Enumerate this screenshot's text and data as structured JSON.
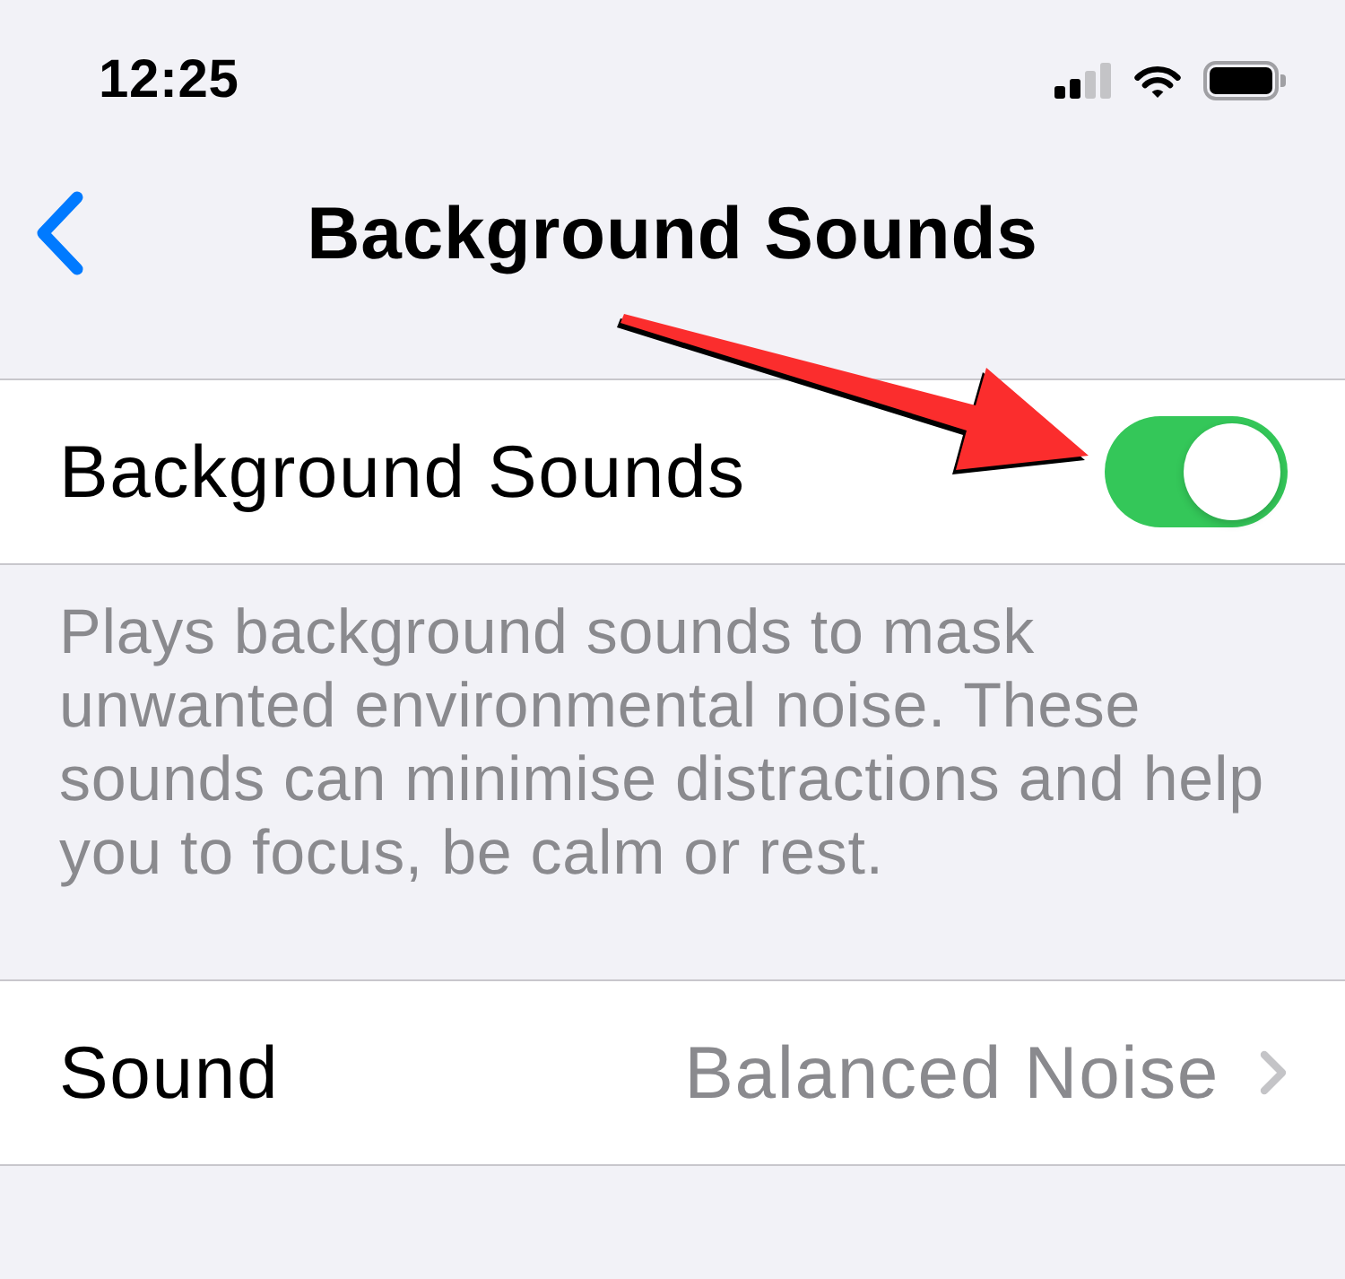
{
  "status_bar": {
    "time": "12:25"
  },
  "nav_bar": {
    "title": "Background Sounds"
  },
  "sections": [
    {
      "rows": [
        {
          "kind": "toggle",
          "label": "Background Sounds",
          "on": true
        }
      ],
      "footer": "Plays background sounds to mask unwanted environmental noise. These sounds can minimise distractions and help you to focus, be calm or rest."
    },
    {
      "rows": [
        {
          "kind": "disclosure",
          "label": "Sound",
          "value": "Balanced Noise"
        }
      ]
    }
  ],
  "annotations": [
    {
      "kind": "arrow"
    }
  ]
}
